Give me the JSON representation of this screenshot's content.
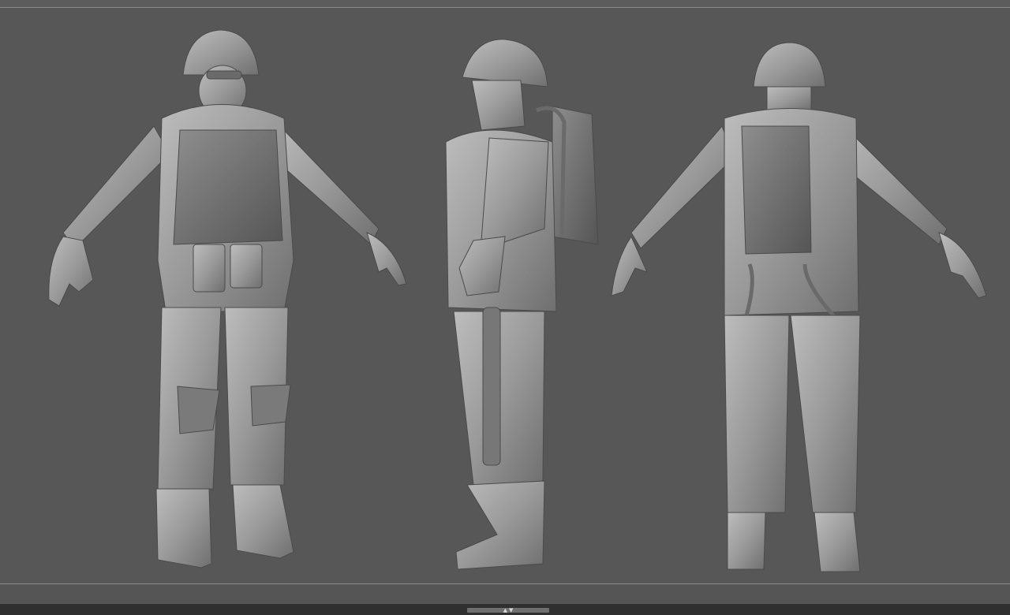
{
  "viewport": {
    "background": "#575757",
    "model_color": "#9c9c9c",
    "views": [
      {
        "name": "front"
      },
      {
        "name": "side"
      },
      {
        "name": "back"
      }
    ]
  },
  "bottom_tray": {
    "icon": "tray-toggle-icon",
    "arrows": [
      "▲",
      "▼"
    ]
  }
}
